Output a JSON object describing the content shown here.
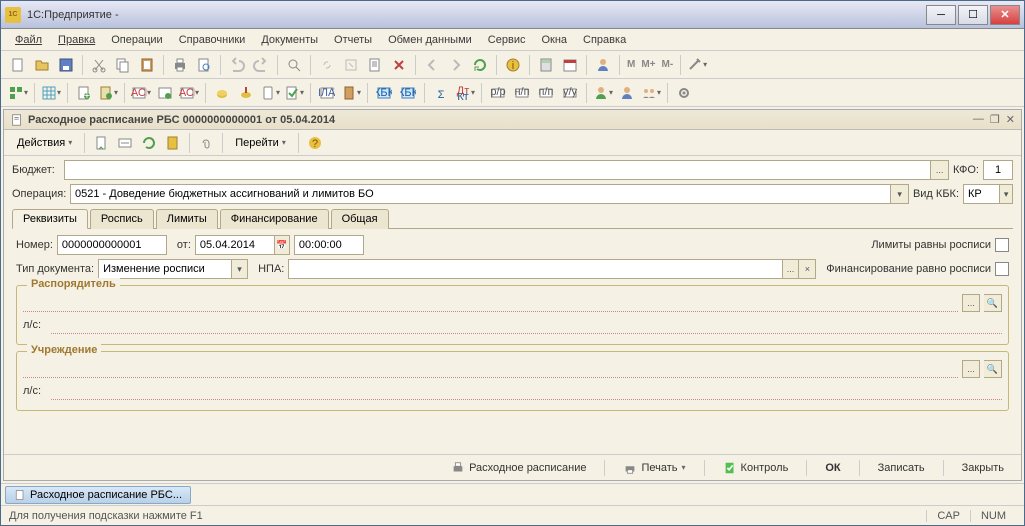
{
  "title": "1С:Предприятие -",
  "menu": [
    "Файл",
    "Правка",
    "Операции",
    "Справочники",
    "Документы",
    "Отчеты",
    "Обмен данными",
    "Сервис",
    "Окна",
    "Справка"
  ],
  "doc_title": "Расходное расписание РБС 0000000000001 от 05.04.2014",
  "actions_label": "Действия",
  "goto_label": "Перейти",
  "f": {
    "budget_label": "Бюджет:",
    "kfo_label": "КФО:",
    "kfo_val": "1",
    "op_label": "Операция:",
    "op_val": "0521 - Доведение бюджетных ассигнований и лимитов БО",
    "kbk_label": "Вид КБК:",
    "kbk_val": "КР",
    "tabs": [
      "Реквизиты",
      "Роспись",
      "Лимиты",
      "Финансирование",
      "Общая"
    ],
    "num_label": "Номер:",
    "num_val": "0000000000001",
    "from_label": "от:",
    "date_val": "05.04.2014",
    "time_val": "00:00:00",
    "lim_eq": "Лимиты равны росписи",
    "doctype_label": "Тип документа:",
    "doctype_val": "Изменение росписи",
    "npa_label": "НПА:",
    "fin_eq": "Финансирование равно росписи",
    "rasp_legend": "Распорядитель",
    "ls_label": "л/с:",
    "uchr_legend": "Учреждение"
  },
  "bottom": {
    "rasp": "Расходное расписание",
    "print": "Печать",
    "ctrl": "Контроль",
    "ok": "ОК",
    "save": "Записать",
    "close": "Закрыть"
  },
  "task": "Расходное расписание РБС...",
  "status_hint": "Для получения подсказки нажмите F1",
  "status_cap": "CAP",
  "status_num": "NUM"
}
